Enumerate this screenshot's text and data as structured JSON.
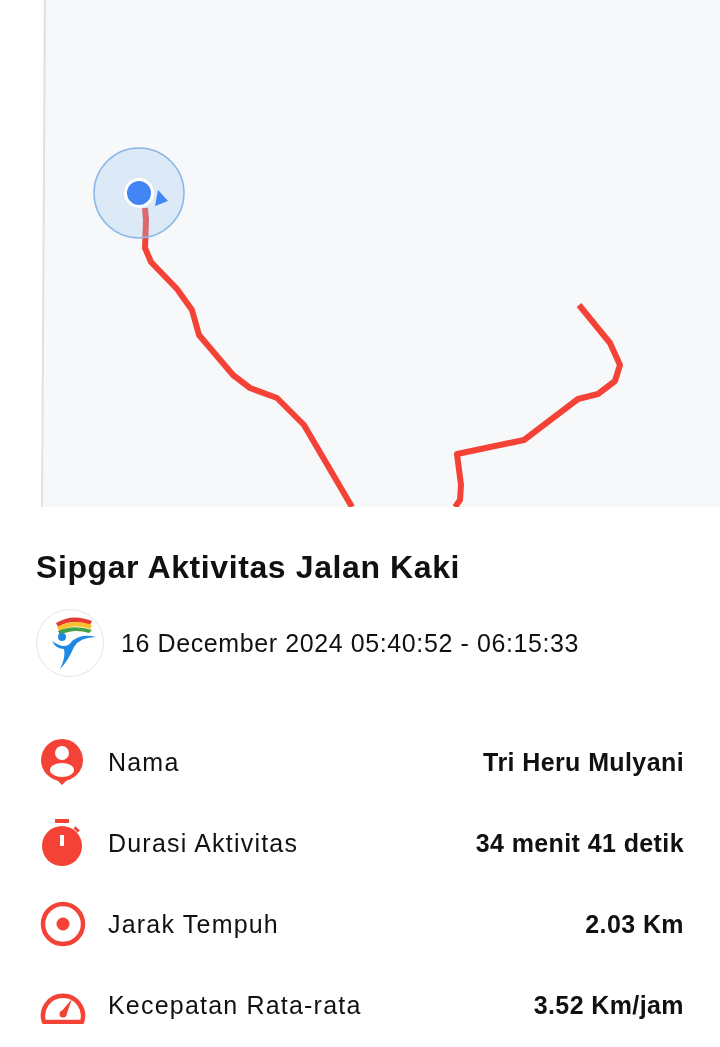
{
  "activity": {
    "title": "Sipgar Aktivitas Jalan Kaki",
    "date_range": "16 December 2024 05:40:52 - 06:15:33"
  },
  "stats": [
    {
      "kind": "person",
      "label": "Nama",
      "value": "Tri Heru Mulyani"
    },
    {
      "kind": "timer",
      "label": "Durasi Aktivitas",
      "value": "34 menit 41 detik"
    },
    {
      "kind": "target",
      "label": "Jarak Tempuh",
      "value": "2.03 Km"
    },
    {
      "kind": "speed",
      "label": "Kecepatan Rata-rata",
      "value": "3.52 Km/jam"
    }
  ]
}
